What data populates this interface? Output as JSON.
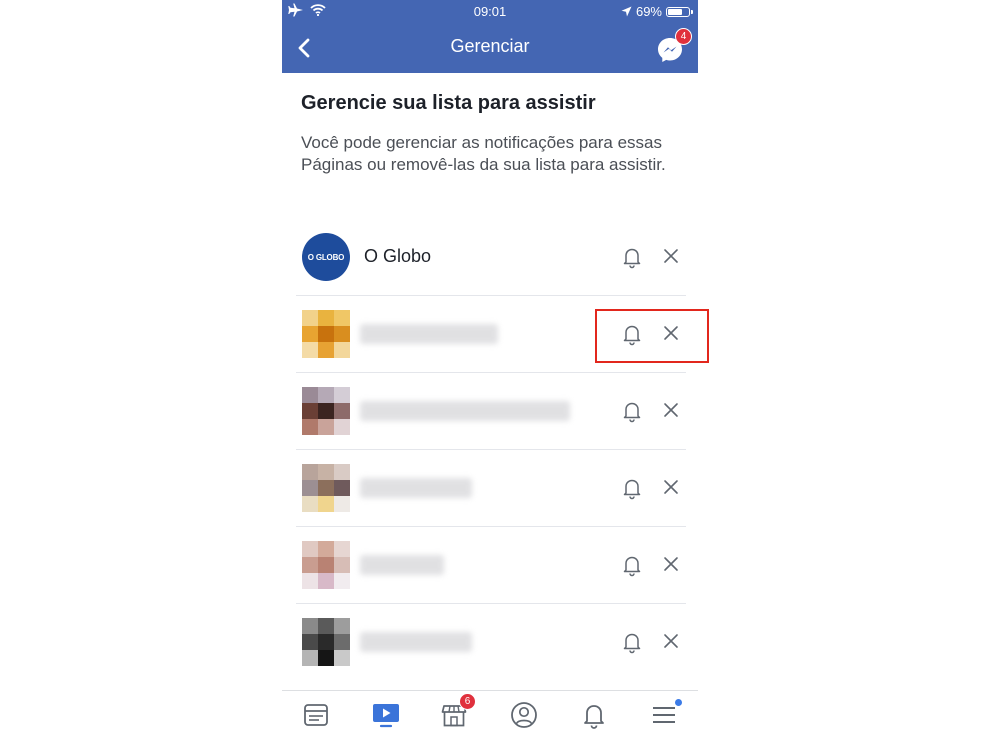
{
  "status_bar": {
    "time": "09:01",
    "battery": "69%",
    "battery_level": 0.69
  },
  "header": {
    "title": "Gerenciar",
    "messenger_badge": "4"
  },
  "heading": "Gerencie sua lista para assistir",
  "description": "Você pode gerenciar as notificações para essas Páginas ou removê-las da sua lista para assistir.",
  "pages": [
    {
      "name": "O Globo",
      "avatar_text": "O GLOBO"
    },
    {
      "name": ""
    },
    {
      "name": ""
    },
    {
      "name": ""
    },
    {
      "name": ""
    },
    {
      "name": ""
    }
  ],
  "tab_bar": {
    "marketplace_badge": "6"
  },
  "colors": {
    "brand": "#4466b3",
    "badge": "#e0313d",
    "highlight": "#e2271d"
  }
}
